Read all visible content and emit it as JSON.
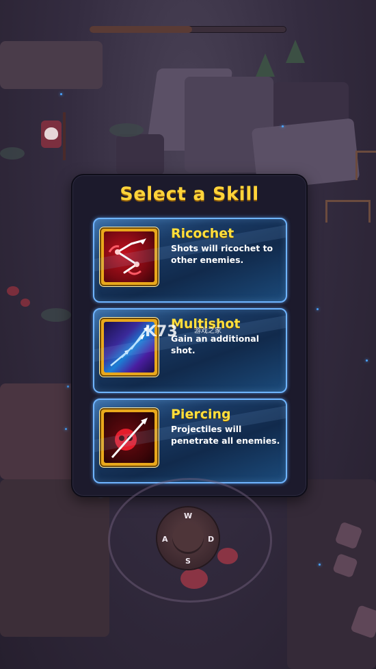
{
  "hud": {
    "progress": 0.52
  },
  "modal": {
    "title": "Select a Skill",
    "skills": [
      {
        "name": "Ricochet",
        "description": "Shots will ricochet to other enemies.",
        "icon": "ricochet-icon"
      },
      {
        "name": "Multishot",
        "description": "Gain an additional shot.",
        "icon": "multishot-icon"
      },
      {
        "name": "Piercing",
        "description": "Projectiles will penetrate all enemies.",
        "icon": "piercing-icon"
      }
    ]
  },
  "watermark": {
    "text": "K73",
    "sub": "游戏之家"
  },
  "controls": {
    "up": "W",
    "left": "A",
    "right": "D",
    "down": "S"
  },
  "colors": {
    "title": "#ffd43a",
    "accent": "#6fb4ff",
    "skill_name": "#ffdf3c"
  }
}
